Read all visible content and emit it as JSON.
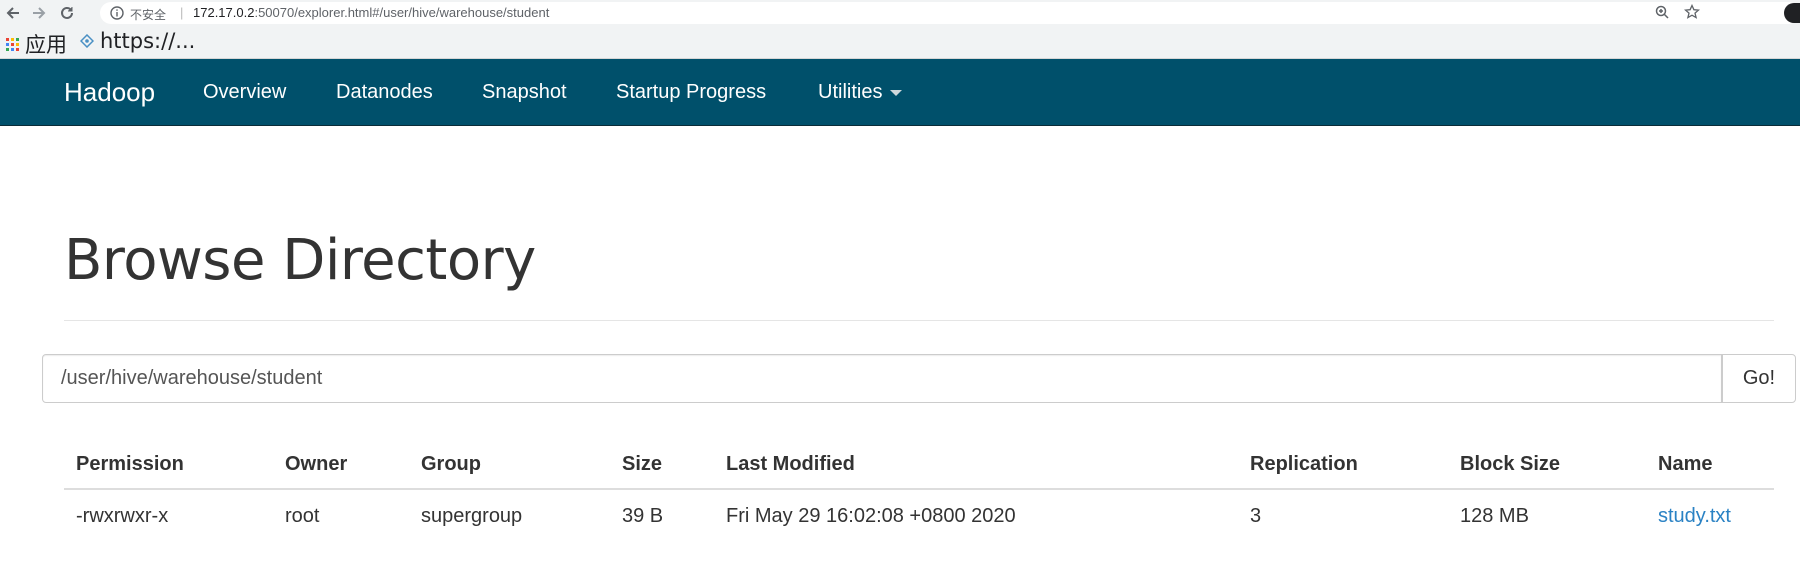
{
  "browser": {
    "security_label": "不安全",
    "separator": "|",
    "url_host": "172.17.0.2",
    "url_rest": ":50070/explorer.html#/user/hive/warehouse/student",
    "bookmarks": [
      {
        "label": "应用",
        "icon": "apps-grid-icon"
      },
      {
        "label": "https://...",
        "icon": "bookmark-site-icon"
      }
    ]
  },
  "navbar": {
    "brand": "Hadoop",
    "items": [
      "Overview",
      "Datanodes",
      "Snapshot",
      "Startup Progress",
      "Utilities"
    ],
    "bg_color": "#00506b"
  },
  "page": {
    "title": "Browse Directory",
    "path_value": "/user/hive/warehouse/student",
    "go_label": "Go!"
  },
  "table": {
    "headers": [
      "Permission",
      "Owner",
      "Group",
      "Size",
      "Last Modified",
      "Replication",
      "Block Size",
      "Name"
    ],
    "rows": [
      [
        "-rwxrwxr-x",
        "root",
        "supergroup",
        "39 B",
        "Fri May 29 16:02:08 +0800 2020",
        "3",
        "128 MB",
        "study.txt"
      ]
    ],
    "link_color": "#2a82c4"
  }
}
